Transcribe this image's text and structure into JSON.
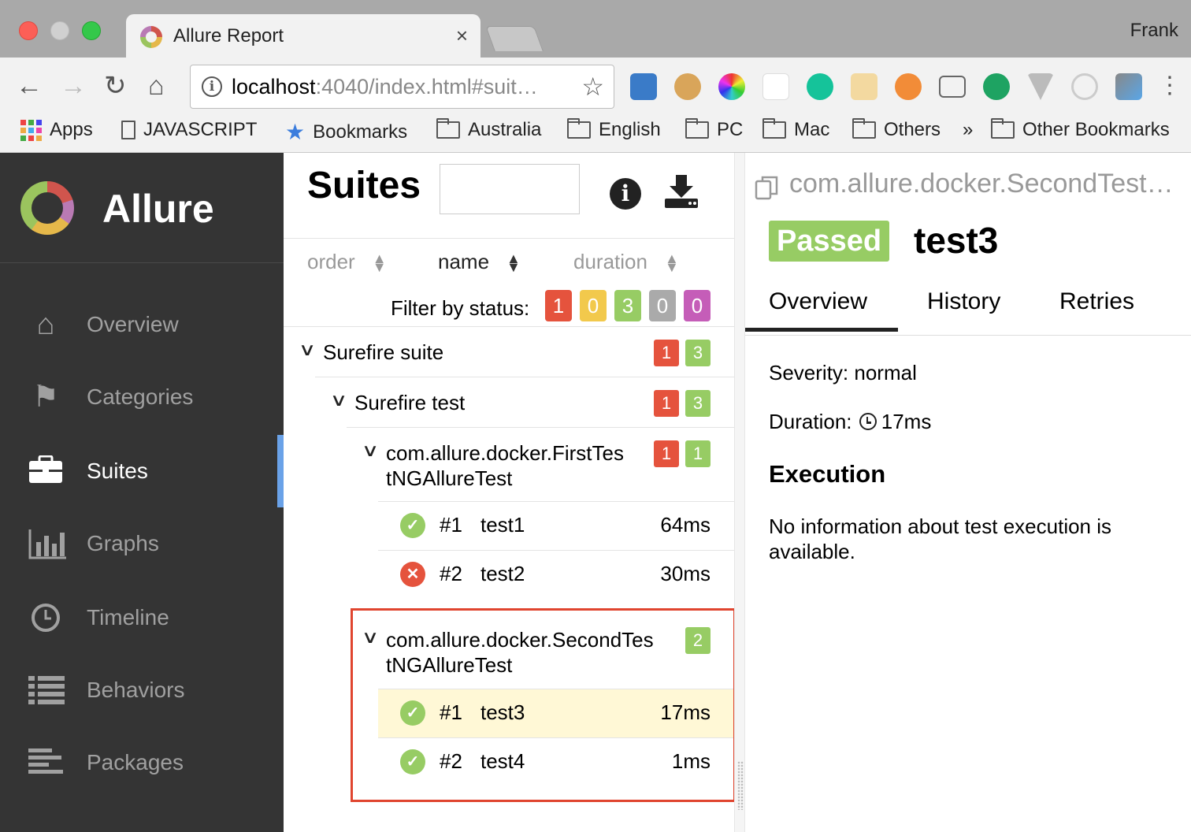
{
  "browser": {
    "tab_title": "Allure Report",
    "tab_close": "×",
    "profile_name": "Frank",
    "url_host": "localhost",
    "url_rest": ":4040/index.html#suit…",
    "bookmarks": [
      "Apps",
      "JAVASCRIPT",
      "Bookmarks",
      "Australia",
      "English",
      "PC",
      "Mac",
      "Others",
      "»",
      "Other Bookmarks"
    ]
  },
  "sidebar": {
    "brand": "Allure",
    "items": [
      {
        "label": "Overview",
        "icon": "home-icon"
      },
      {
        "label": "Categories",
        "icon": "flag-icon"
      },
      {
        "label": "Suites",
        "icon": "briefcase-icon"
      },
      {
        "label": "Graphs",
        "icon": "bar-chart-icon"
      },
      {
        "label": "Timeline",
        "icon": "clock-icon"
      },
      {
        "label": "Behaviors",
        "icon": "list-icon"
      },
      {
        "label": "Packages",
        "icon": "align-left-icon"
      }
    ],
    "active": "Suites"
  },
  "suites": {
    "title": "Suites",
    "sort": {
      "order": "order",
      "name": "name",
      "duration": "duration"
    },
    "filter_label": "Filter by status:",
    "filter_counts": [
      {
        "value": "1",
        "color": "#e5533d"
      },
      {
        "value": "0",
        "color": "#f2c94c"
      },
      {
        "value": "3",
        "color": "#97cc64"
      },
      {
        "value": "0",
        "color": "#aaaaaa"
      },
      {
        "value": "0",
        "color": "#c55db8"
      }
    ],
    "tree": {
      "suite": {
        "name": "Surefire suite",
        "failed": "1",
        "passed": "3"
      },
      "test": {
        "name": "Surefire test",
        "failed": "1",
        "passed": "3"
      },
      "class1": {
        "name_line1": "com.allure.docker.FirstTes",
        "name_line2": "tNGAllureTest",
        "failed": "1",
        "passed": "1",
        "cases": [
          {
            "num": "#1",
            "name": "test1",
            "duration": "64ms",
            "status": "passed"
          },
          {
            "num": "#2",
            "name": "test2",
            "duration": "30ms",
            "status": "failed"
          }
        ]
      },
      "class2": {
        "name_line1": "com.allure.docker.SecondTes",
        "name_line2": "tNGAllureTest",
        "passed": "2",
        "cases": [
          {
            "num": "#1",
            "name": "test3",
            "duration": "17ms",
            "status": "passed"
          },
          {
            "num": "#2",
            "name": "test4",
            "duration": "1ms",
            "status": "passed"
          }
        ]
      }
    }
  },
  "detail": {
    "path": "com.allure.docker.SecondTestNGAllureTest",
    "status": "Passed",
    "title": "test3",
    "tabs": [
      "Overview",
      "History",
      "Retries"
    ],
    "severity": "Severity: normal",
    "duration_label": "Duration:",
    "duration_value": "17ms",
    "execution_title": "Execution",
    "execution_text": "No information about test execution is available."
  },
  "colors": {
    "sidebar_bg": "#343434",
    "passed": "#97cc64",
    "failed": "#e5533d",
    "selected_row": "#fff8d6",
    "highlight": "#e0452f"
  }
}
